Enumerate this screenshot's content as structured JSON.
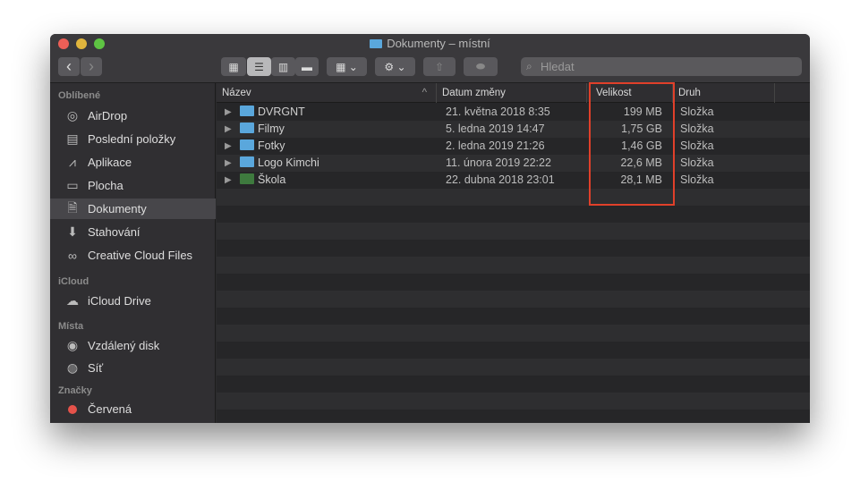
{
  "window": {
    "title": "Dokumenty – místní"
  },
  "toolbar": {
    "back": "‹",
    "forward": "›",
    "search_placeholder": "Hledat"
  },
  "sidebar": {
    "favorites_header": "Oblíbené",
    "favorites": [
      {
        "label": "AirDrop",
        "icon": "◎"
      },
      {
        "label": "Poslední položky",
        "icon": "▤"
      },
      {
        "label": "Aplikace",
        "icon": "⩘"
      },
      {
        "label": "Plocha",
        "icon": "▭"
      },
      {
        "label": "Dokumenty",
        "icon": "🗎"
      },
      {
        "label": "Stahování",
        "icon": "⬇"
      },
      {
        "label": "Creative Cloud Files",
        "icon": "∞"
      }
    ],
    "icloud_header": "iCloud",
    "icloud": [
      {
        "label": "iCloud Drive",
        "icon": "☁"
      }
    ],
    "places_header": "Místa",
    "places": [
      {
        "label": "Vzdálený disk",
        "icon": "◉"
      },
      {
        "label": "Síť",
        "icon": "◍"
      }
    ],
    "tags_header": "Značky",
    "tags": [
      {
        "label": "Červená",
        "color": "#e5524a"
      }
    ]
  },
  "columns": {
    "name": "Název",
    "date": "Datum změny",
    "size": "Velikost",
    "kind": "Druh"
  },
  "files": [
    {
      "name": "DVRGNT",
      "date": "21. května 2018 8:35",
      "size": "199 MB",
      "kind": "Složka",
      "color": "#5aa7dc"
    },
    {
      "name": "Filmy",
      "date": "5. ledna 2019 14:47",
      "size": "1,75 GB",
      "kind": "Složka",
      "color": "#5aa7dc"
    },
    {
      "name": "Fotky",
      "date": "2. ledna 2019 21:26",
      "size": "1,46 GB",
      "kind": "Složka",
      "color": "#5aa7dc"
    },
    {
      "name": "Logo Kimchi",
      "date": "11. února 2019 22:22",
      "size": "22,6 MB",
      "kind": "Složka",
      "color": "#5aa7dc"
    },
    {
      "name": "Škola",
      "date": "22. dubna 2018 23:01",
      "size": "28,1 MB",
      "kind": "Složka",
      "color": "#3e7a3e"
    }
  ]
}
